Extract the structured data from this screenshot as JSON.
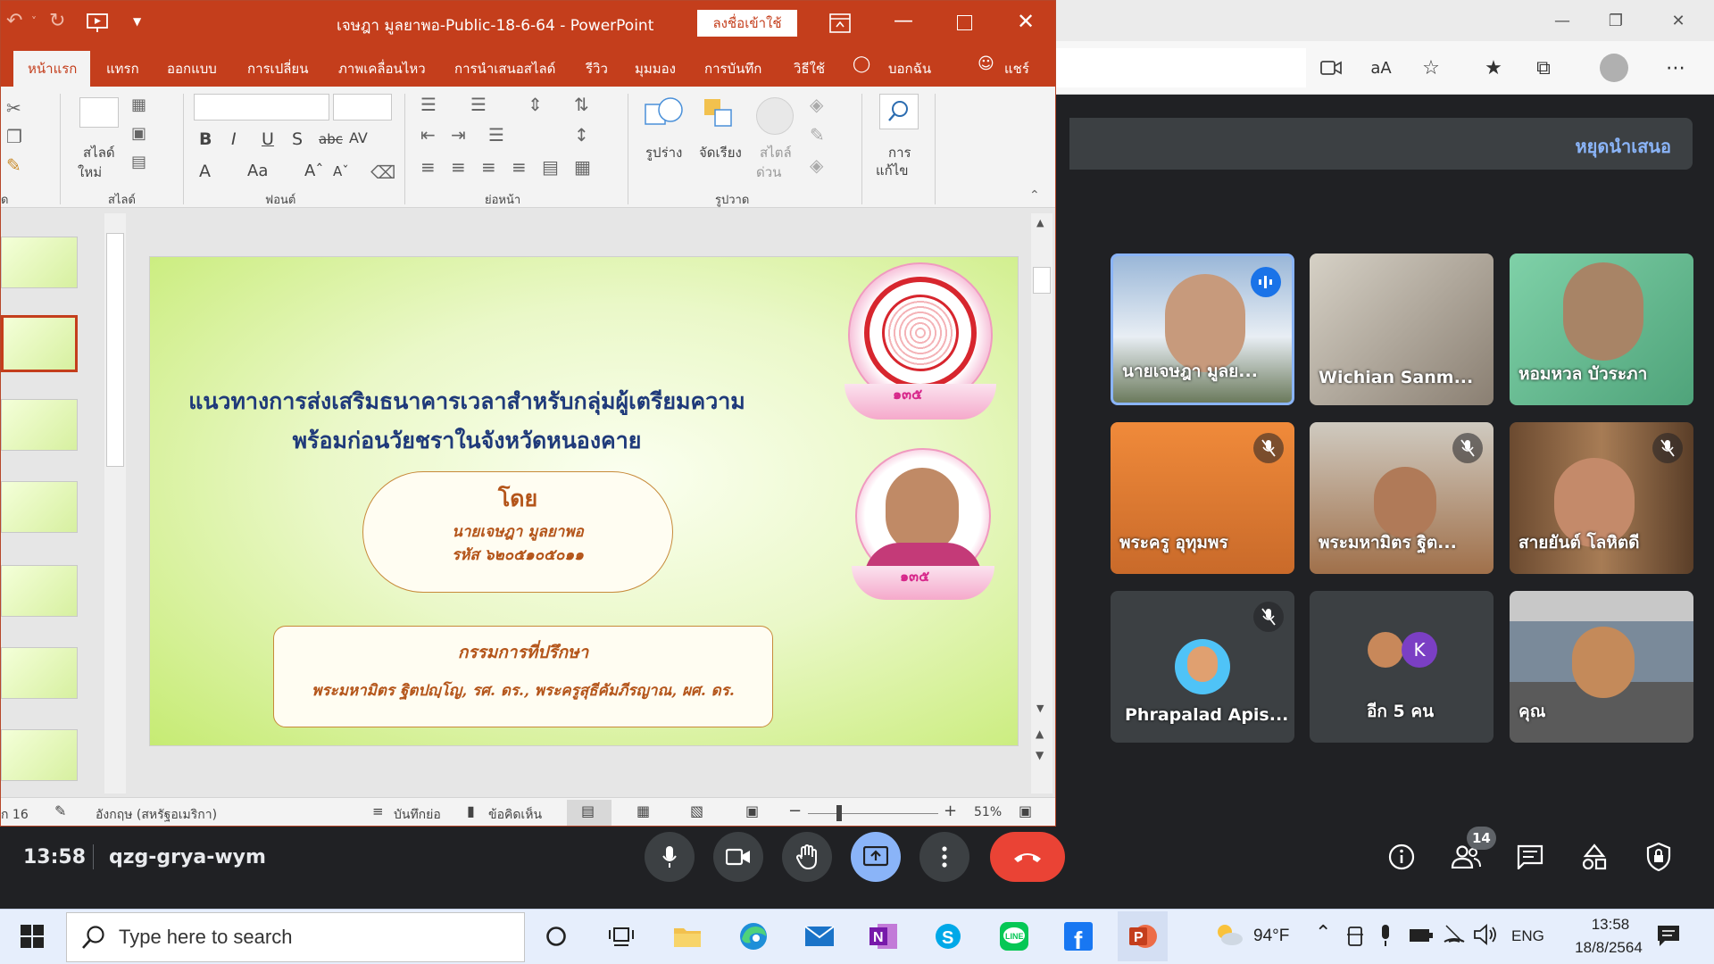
{
  "ppt": {
    "title": "เจษฎา มูลยาพอ-Public-18-6-64  -  PowerPoint",
    "signin": "ลงชื่อเข้าใช้",
    "tabs": [
      "หน้าแรก",
      "แทรก",
      "ออกแบบ",
      "การเปลี่ยน",
      "ภาพเคลื่อนไหว",
      "การนำเสนอสไลด์",
      "รีวิว",
      "มุมมอง",
      "การบันทึก",
      "วิธีใช้",
      "บอกฉัน",
      "แชร์"
    ],
    "ribbon": {
      "group_slides": "สไลด์",
      "group_font": "ฟอนต์",
      "group_paragraph": "ย่อหน้า",
      "group_drawing": "รูปวาด",
      "group_clipboard": "ด",
      "new_slide_1": "สไลด์",
      "new_slide_2": "ใหม่",
      "shape": "รูปร่าง",
      "arrange": "จัดเรียง",
      "quick_style_1": "สไตล์",
      "quick_style_2": "ด่วน",
      "edit_1": "การ",
      "edit_2": "แก้ไข"
    },
    "status": {
      "slide_of": "ก 16",
      "language": "อังกฤษ (สหรัฐอเมริกา)",
      "notes": "บันทึกย่อ",
      "comments": "ข้อคิดเห็น",
      "zoom": "51%"
    },
    "slide": {
      "title_line1": "แนวทางการส่งเสริมธนาคารเวลาสำหรับกลุ่มผู้เตรียมความ",
      "title_line2": "พร้อมก่อนวัยชราในจังหวัดหนองคาย",
      "by": "โดย",
      "name": "นายเจษฎา  มูลยาพอ",
      "code": "รหัส ๖๒๐๕๑๐๕๐๑๑",
      "advisor_title": "กรรมการที่ปรึกษา",
      "advisor_names": "พระมหามิตร ฐิตปญฺโญ, รศ. ดร., พระครูสุธีคัมภีรญาณ, ผศ. ดร.",
      "badge_number": "๑๓๕"
    }
  },
  "meet": {
    "stop_presenting": "หยุดนำเสนอ",
    "time": "13:58",
    "code": "qzg-grya-wym",
    "participants_count": "14",
    "tiles": [
      {
        "name": "นายเจษฎา มูลย...",
        "speaking": true
      },
      {
        "name": "Wichian Sanm...",
        "speaking": false
      },
      {
        "name": "หอมหวล บัวระภา",
        "speaking": false
      },
      {
        "name": "พระครู อุทุมพร",
        "muted": true
      },
      {
        "name": "พระมหามิตร ฐิต...",
        "muted": true
      },
      {
        "name": "สายยันต์ โลหิตดี",
        "muted": true
      },
      {
        "name": "Phrapalad Apis...",
        "muted": true
      },
      {
        "name": "อีก 5 คน",
        "avatar_letter": "K"
      },
      {
        "name": "คุณ"
      }
    ]
  },
  "taskbar": {
    "search_placeholder": "Type here to search",
    "weather": "94°F",
    "lang": "ENG",
    "time": "13:58",
    "date": "18/8/2564"
  },
  "colors": {
    "ppt_accent": "#c43e1c",
    "meet_bg": "#202124",
    "end_call": "#ea4335",
    "present_btn": "#8ab4f8"
  }
}
